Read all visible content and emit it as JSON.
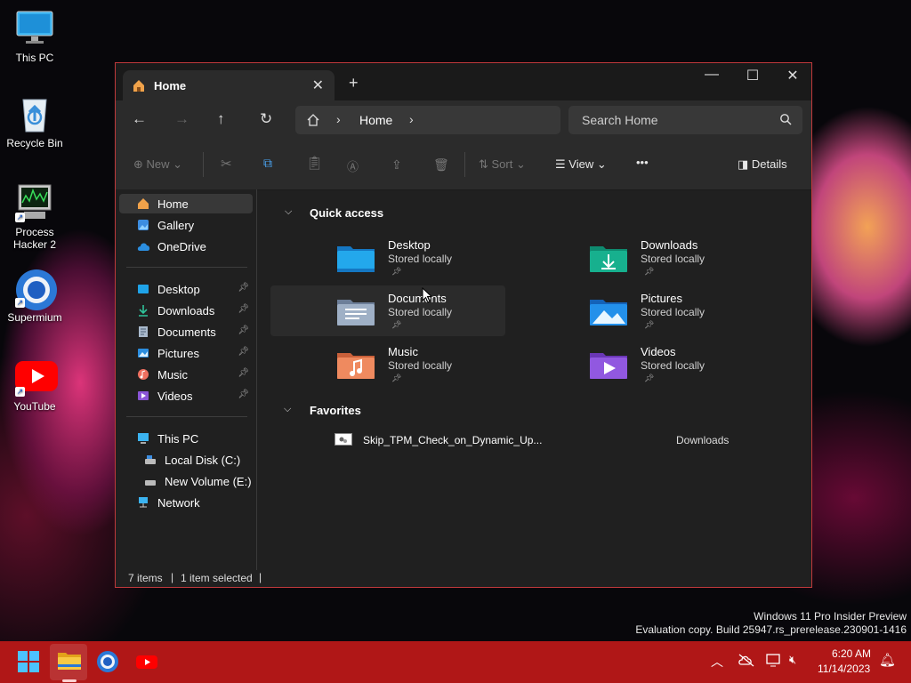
{
  "desktop": {
    "icons": [
      {
        "label": "This PC"
      },
      {
        "label": "Recycle Bin"
      },
      {
        "label": "Process Hacker 2"
      },
      {
        "label": "Supermium"
      },
      {
        "label": "YouTube"
      }
    ]
  },
  "window": {
    "tab": {
      "title": "Home"
    },
    "address": {
      "crumb": "Home"
    },
    "search": {
      "placeholder": "Search Home"
    },
    "toolbar": {
      "new": "New",
      "sort": "Sort",
      "view": "View",
      "more": "•••",
      "details": "Details"
    },
    "sidebar": {
      "top": [
        {
          "label": "Home"
        },
        {
          "label": "Gallery"
        },
        {
          "label": "OneDrive"
        }
      ],
      "pinned": [
        {
          "label": "Desktop"
        },
        {
          "label": "Downloads"
        },
        {
          "label": "Documents"
        },
        {
          "label": "Pictures"
        },
        {
          "label": "Music"
        },
        {
          "label": "Videos"
        }
      ],
      "drives": [
        {
          "label": "This PC"
        },
        {
          "label": "Local Disk (C:)"
        },
        {
          "label": "New Volume (E:)"
        },
        {
          "label": "Network"
        }
      ]
    },
    "quick_access": {
      "title": "Quick access",
      "items": [
        {
          "name": "Desktop",
          "sub": "Stored locally",
          "color": "#1fa3e8"
        },
        {
          "name": "Downloads",
          "sub": "Stored locally",
          "color": "#14a88a"
        },
        {
          "name": "Documents",
          "sub": "Stored locally",
          "color": "#8fa3bd"
        },
        {
          "name": "Pictures",
          "sub": "Stored locally",
          "color": "#1f8fe8"
        },
        {
          "name": "Music",
          "sub": "Stored locally",
          "color": "#ef8a5f"
        },
        {
          "name": "Videos",
          "sub": "Stored locally",
          "color": "#8a54d6"
        }
      ]
    },
    "favorites": {
      "title": "Favorites",
      "items": [
        {
          "name": "Skip_TPM_Check_on_Dynamic_Up...",
          "location": "Downloads"
        }
      ]
    },
    "status": {
      "count": "7 items",
      "selected": "1 item selected"
    }
  },
  "watermark": {
    "line1": "Windows 11 Pro Insider Preview",
    "line2": "Evaluation copy. Build 25947.rs_prerelease.230901-1416"
  },
  "taskbar": {
    "time": "6:20 AM",
    "date": "11/14/2023",
    "accent": "#b01717"
  }
}
